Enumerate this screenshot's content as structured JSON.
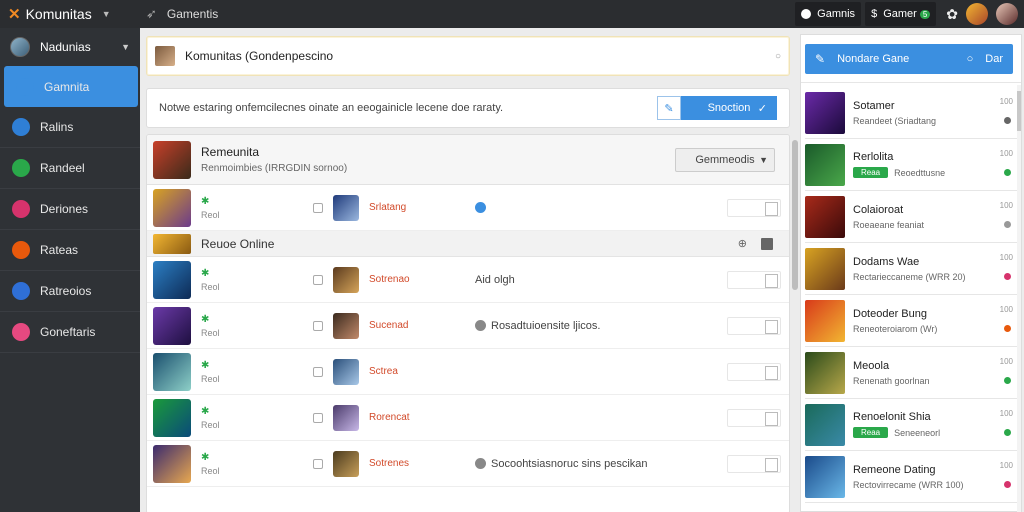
{
  "topbar": {
    "app_name": "Komunitas",
    "tool_label": "Gamentis",
    "btn1_label": "Gamnis",
    "btn2_label": "Gamer",
    "btn2_badge": "5"
  },
  "sidebar": {
    "user_name": "Nadunias",
    "items": [
      {
        "label": "Gamnita",
        "color": "#3b8fe0",
        "active": true
      },
      {
        "label": "Ralins",
        "color": "#2f7fd6"
      },
      {
        "label": "Randeel",
        "color": "#2aa84a"
      },
      {
        "label": "Deriones",
        "color": "#d6336c"
      },
      {
        "label": "Rateas",
        "color": "#e8590c"
      },
      {
        "label": "Ratreoios",
        "color": "#2f6fd6"
      },
      {
        "label": "Goneftaris",
        "color": "#e64980"
      }
    ]
  },
  "main": {
    "header_title": "Komunitas (Gondenpescino",
    "message": "Notwe estaring onfemcilecnes oinate an eeogainicle lecene doe raraty.",
    "message_button": "Snoction",
    "list_head": {
      "title": "Remeunita",
      "subtitle": "Renmoimbies (IRRGDIN sornoo)",
      "select_label": "Gemmeodis"
    },
    "rows_top": [
      {
        "level": "Reol",
        "name": "Srlatang",
        "note": "",
        "note_color": "#3b8fe0",
        "av": "#d8a322,#6b3a8c",
        "av2": "#1f3a7a,#9bb8e0"
      }
    ],
    "section": {
      "label": "Reuoe Online"
    },
    "rows": [
      {
        "level": "Reol",
        "name": "Sotrenao",
        "note": "Aid olgh",
        "note_color": "",
        "av": "#2c7fc4,#0d2a55",
        "av2": "#5a3a1e,#d6a55a"
      },
      {
        "level": "Reol",
        "name": "Sucenad",
        "note": "Rosadtuioensite ljicos.",
        "note_color": "#888",
        "av": "#6b3aa8,#1e0f40",
        "av2": "#3a2a1e,#c28a6a"
      },
      {
        "level": "Reol",
        "name": "Sctrea",
        "note": "",
        "note_color": "",
        "av": "#1a4f6e,#8ed0c8",
        "av2": "#2a4f7a,#a8c8e8"
      },
      {
        "level": "Reol",
        "name": "Rorencat",
        "note": "",
        "note_color": "",
        "av": "#1a9a3a,#0a4a7a",
        "av2": "#4a3a6a,#c8b8e8"
      },
      {
        "level": "Reol",
        "name": "Sotrenes",
        "note": "Socoohtsiasnoruc sins pescikan",
        "note_color": "#888",
        "av": "#3a2a6e,#e8a850",
        "av2": "#4a3a1e,#c8a05a"
      }
    ]
  },
  "right_panel": {
    "button_label": "Nondare Gane",
    "button_extra": "Dar",
    "games": [
      {
        "name": "Sotamer",
        "sub": "Reandeet (Sriadtang",
        "tag": "",
        "count": "100",
        "status": "#666",
        "av": "#6b2aa8,#1a0a3a"
      },
      {
        "name": "Rerlolita",
        "sub": "Reoedttusne",
        "tag": "Reaa",
        "count": "100",
        "status": "#2aa84a",
        "av": "#1a5a2a,#4aa84a"
      },
      {
        "name": "Colaioroat",
        "sub": "Roeaeane feaniat",
        "tag": "",
        "count": "100",
        "status": "#999",
        "av": "#a82a1a,#3a0a0a"
      },
      {
        "name": "Dodams Wae",
        "sub": "Rectarieccaneme (WRR 20)",
        "tag": "",
        "count": "100",
        "status": "#d6336c",
        "av": "#d8a322,#6b3a1a"
      },
      {
        "name": "Doteoder Bung",
        "sub": "Reneoteroiarom (Wr)",
        "tag": "",
        "count": "100",
        "status": "#e8590c",
        "av": "#d83a1a,#f2b632"
      },
      {
        "name": "Meoola",
        "sub": "Renenath goorlnan",
        "tag": "",
        "count": "100",
        "status": "#2aa84a",
        "av": "#2a4a1a,#b8a84a"
      },
      {
        "name": "Renoelonit Shia",
        "sub": "Seneeneorl",
        "tag": "Reaa",
        "count": "100",
        "status": "#2aa84a",
        "av": "#1a6a5a,#3a8aa8"
      },
      {
        "name": "Remeone Dating",
        "sub": "Rectovirrecame (WRR 100)",
        "tag": "",
        "count": "100",
        "status": "#d6336c",
        "av": "#1a4a8a,#6ab8e8"
      }
    ]
  }
}
